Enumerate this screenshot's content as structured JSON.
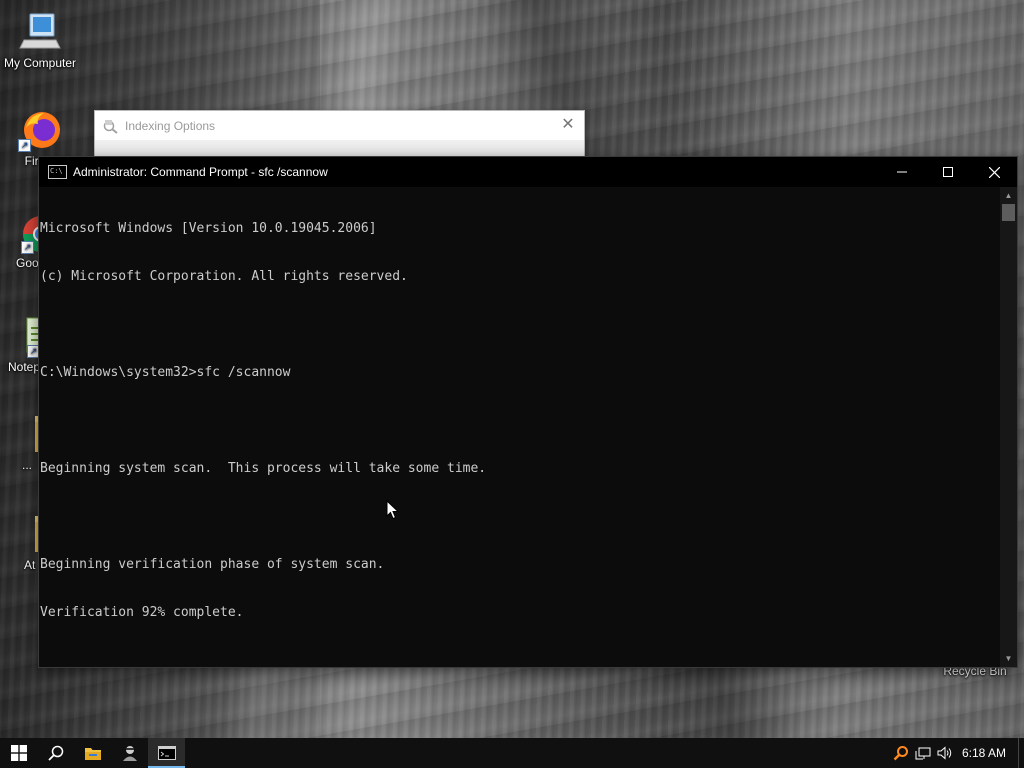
{
  "desktop": {
    "icons": [
      {
        "label": "My Computer"
      },
      {
        "label": "Fire"
      },
      {
        "label": "Goo Chro"
      },
      {
        "label": "Notep"
      },
      {
        "label": "..."
      },
      {
        "label": "At"
      }
    ],
    "recycle_bin_label": "Recycle Bin"
  },
  "indexing_window": {
    "title": "Indexing Options"
  },
  "cmd_window": {
    "title": "Administrator:  Command Prompt - sfc  /scannow",
    "lines": [
      "Microsoft Windows [Version 10.0.19045.2006]",
      "(c) Microsoft Corporation. All rights reserved.",
      "",
      "C:\\Windows\\system32>sfc /scannow",
      "",
      "Beginning system scan.  This process will take some time.",
      "",
      "Beginning verification phase of system scan.",
      "Verification 92% complete."
    ],
    "controls": {
      "minimize": "minimize-icon",
      "maximize": "maximize-icon",
      "close": "close-icon"
    }
  },
  "taskbar": {
    "buttons": [
      "windows-start-icon",
      "search-icon",
      "file-explorer-icon",
      "user-app-icon",
      "command-prompt-icon"
    ],
    "active": "command-prompt-icon",
    "tray": {
      "icons": [
        "search-tray-icon",
        "network-icon",
        "volume-icon"
      ],
      "time": "6:18 AM"
    }
  },
  "colors": {
    "console_bg": "#0c0c0c",
    "console_text": "#cccccc",
    "taskbar_bg": "#101010",
    "accent": "#76b9ed"
  }
}
